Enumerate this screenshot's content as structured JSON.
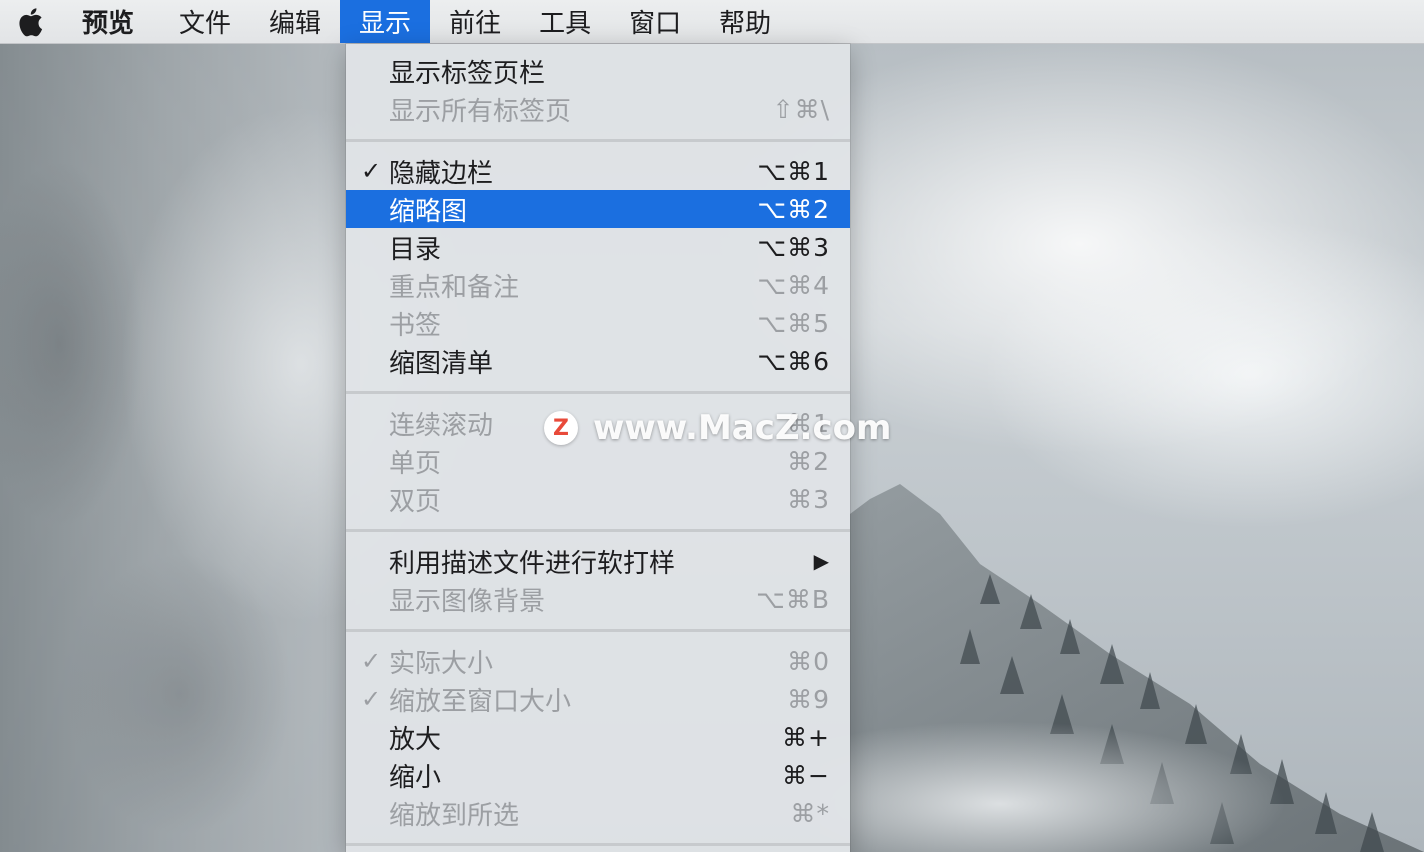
{
  "menubar": {
    "apple_icon": "apple-icon",
    "app_name": "预览",
    "items": [
      "文件",
      "编辑",
      "显示",
      "前往",
      "工具",
      "窗口",
      "帮助"
    ],
    "active": "显示"
  },
  "menu": {
    "groups": [
      [
        {
          "label": "显示标签页栏",
          "shortcut": "",
          "enabled": true,
          "checked": false
        },
        {
          "label": "显示所有标签页",
          "shortcut": "⇧⌘\\",
          "enabled": false,
          "checked": false
        }
      ],
      [
        {
          "label": "隐藏边栏",
          "shortcut": "⌥⌘1",
          "enabled": true,
          "checked": true
        },
        {
          "label": "缩略图",
          "shortcut": "⌥⌘2",
          "enabled": true,
          "checked": false,
          "highlighted": true
        },
        {
          "label": "目录",
          "shortcut": "⌥⌘3",
          "enabled": true,
          "checked": false
        },
        {
          "label": "重点和备注",
          "shortcut": "⌥⌘4",
          "enabled": false,
          "checked": false
        },
        {
          "label": "书签",
          "shortcut": "⌥⌘5",
          "enabled": false,
          "checked": false
        },
        {
          "label": "缩图清单",
          "shortcut": "⌥⌘6",
          "enabled": true,
          "checked": false
        }
      ],
      [
        {
          "label": "连续滚动",
          "shortcut": "⌘1",
          "enabled": false,
          "checked": false
        },
        {
          "label": "单页",
          "shortcut": "⌘2",
          "enabled": false,
          "checked": false
        },
        {
          "label": "双页",
          "shortcut": "⌘3",
          "enabled": false,
          "checked": false
        }
      ],
      [
        {
          "label": "利用描述文件进行软打样",
          "shortcut": "▶",
          "enabled": true,
          "checked": false,
          "submenu": true
        },
        {
          "label": "显示图像背景",
          "shortcut": "⌥⌘B",
          "enabled": false,
          "checked": false
        }
      ],
      [
        {
          "label": "实际大小",
          "shortcut": "⌘0",
          "enabled": false,
          "checked": true
        },
        {
          "label": "缩放至窗口大小",
          "shortcut": "⌘9",
          "enabled": false,
          "checked": true
        },
        {
          "label": "放大",
          "shortcut": "⌘+",
          "enabled": true,
          "checked": false
        },
        {
          "label": "缩小",
          "shortcut": "⌘−",
          "enabled": true,
          "checked": false
        },
        {
          "label": "缩放到所选",
          "shortcut": "⌘*",
          "enabled": false,
          "checked": false
        }
      ]
    ],
    "check_mark": "✓"
  },
  "watermark": {
    "logo_letter": "Z",
    "text": "www.MacZ.com"
  },
  "colors": {
    "highlight": "#1b6fe0",
    "disabled_text": "#9c9fa3",
    "logo_red": "#e84a3a"
  }
}
